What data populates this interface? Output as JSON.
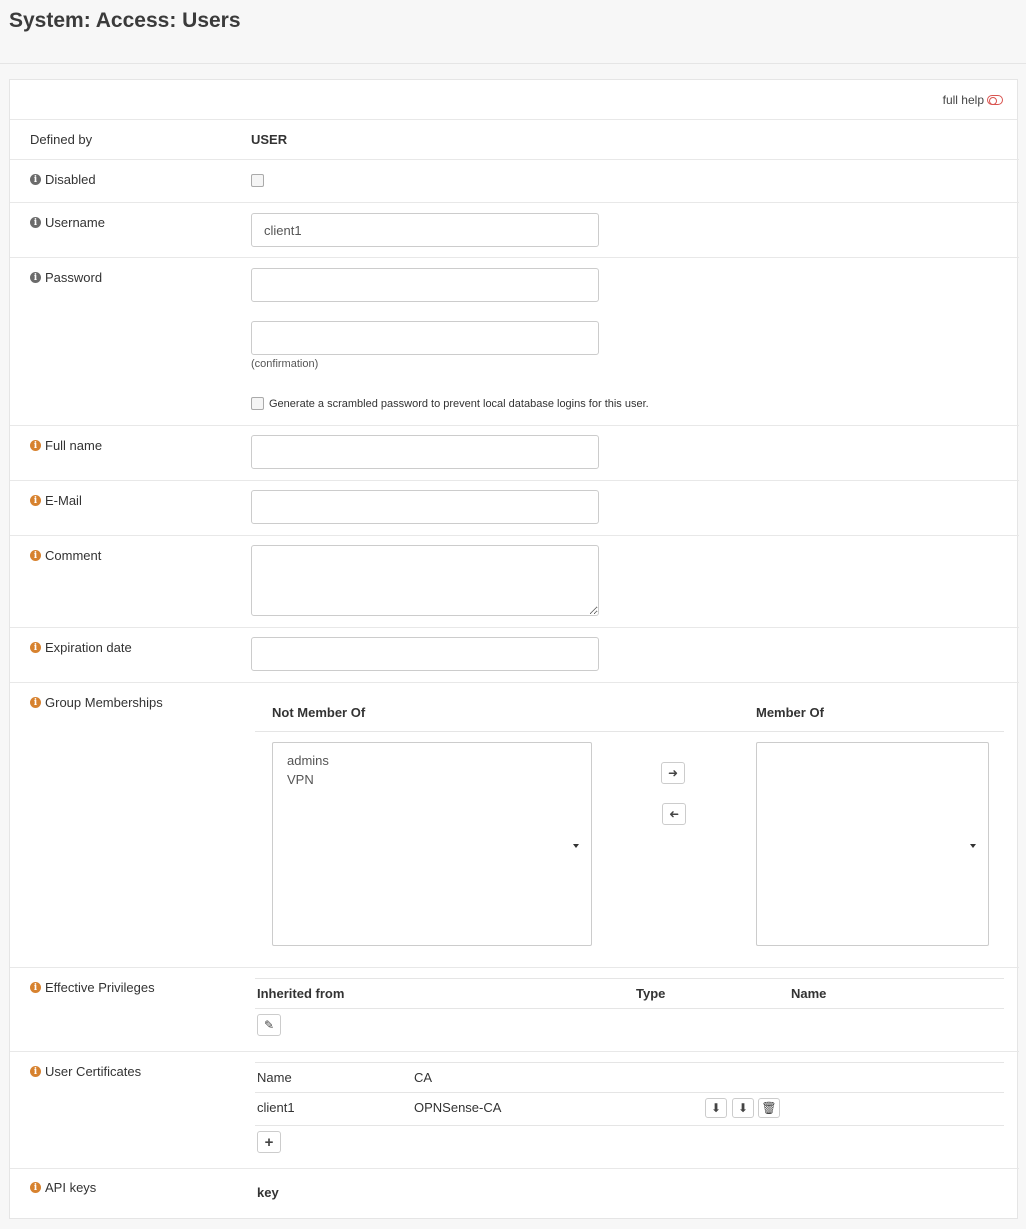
{
  "page": {
    "title": "System: Access: Users"
  },
  "help": {
    "label": "full help"
  },
  "fields": {
    "defined_by": {
      "label": "Defined by",
      "value": "USER"
    },
    "disabled": {
      "label": "Disabled"
    },
    "username": {
      "label": "Username",
      "value": "client1"
    },
    "password": {
      "label": "Password",
      "confirmation_note": "(confirmation)",
      "scramble_label": "Generate a scrambled password to prevent local database logins for this user."
    },
    "full_name": {
      "label": "Full name",
      "value": ""
    },
    "email": {
      "label": "E-Mail",
      "value": ""
    },
    "comment": {
      "label": "Comment",
      "value": ""
    },
    "expiration": {
      "label": "Expiration date",
      "value": ""
    }
  },
  "groups": {
    "label": "Group Memberships",
    "not_member_header": "Not Member Of",
    "member_header": "Member Of",
    "not_member": [
      "admins",
      "VPN"
    ],
    "member": []
  },
  "privileges": {
    "label": "Effective Privileges",
    "columns": [
      "Inherited from",
      "Type",
      "Name"
    ]
  },
  "certificates": {
    "label": "User Certificates",
    "columns": [
      "Name",
      "CA"
    ],
    "rows": [
      {
        "name": "client1",
        "ca": "OPNSense-CA"
      }
    ]
  },
  "api_keys": {
    "label": "API keys",
    "column": "key"
  },
  "colors": {
    "info_icon": "#d7822f",
    "toggle": "#d9534f"
  }
}
